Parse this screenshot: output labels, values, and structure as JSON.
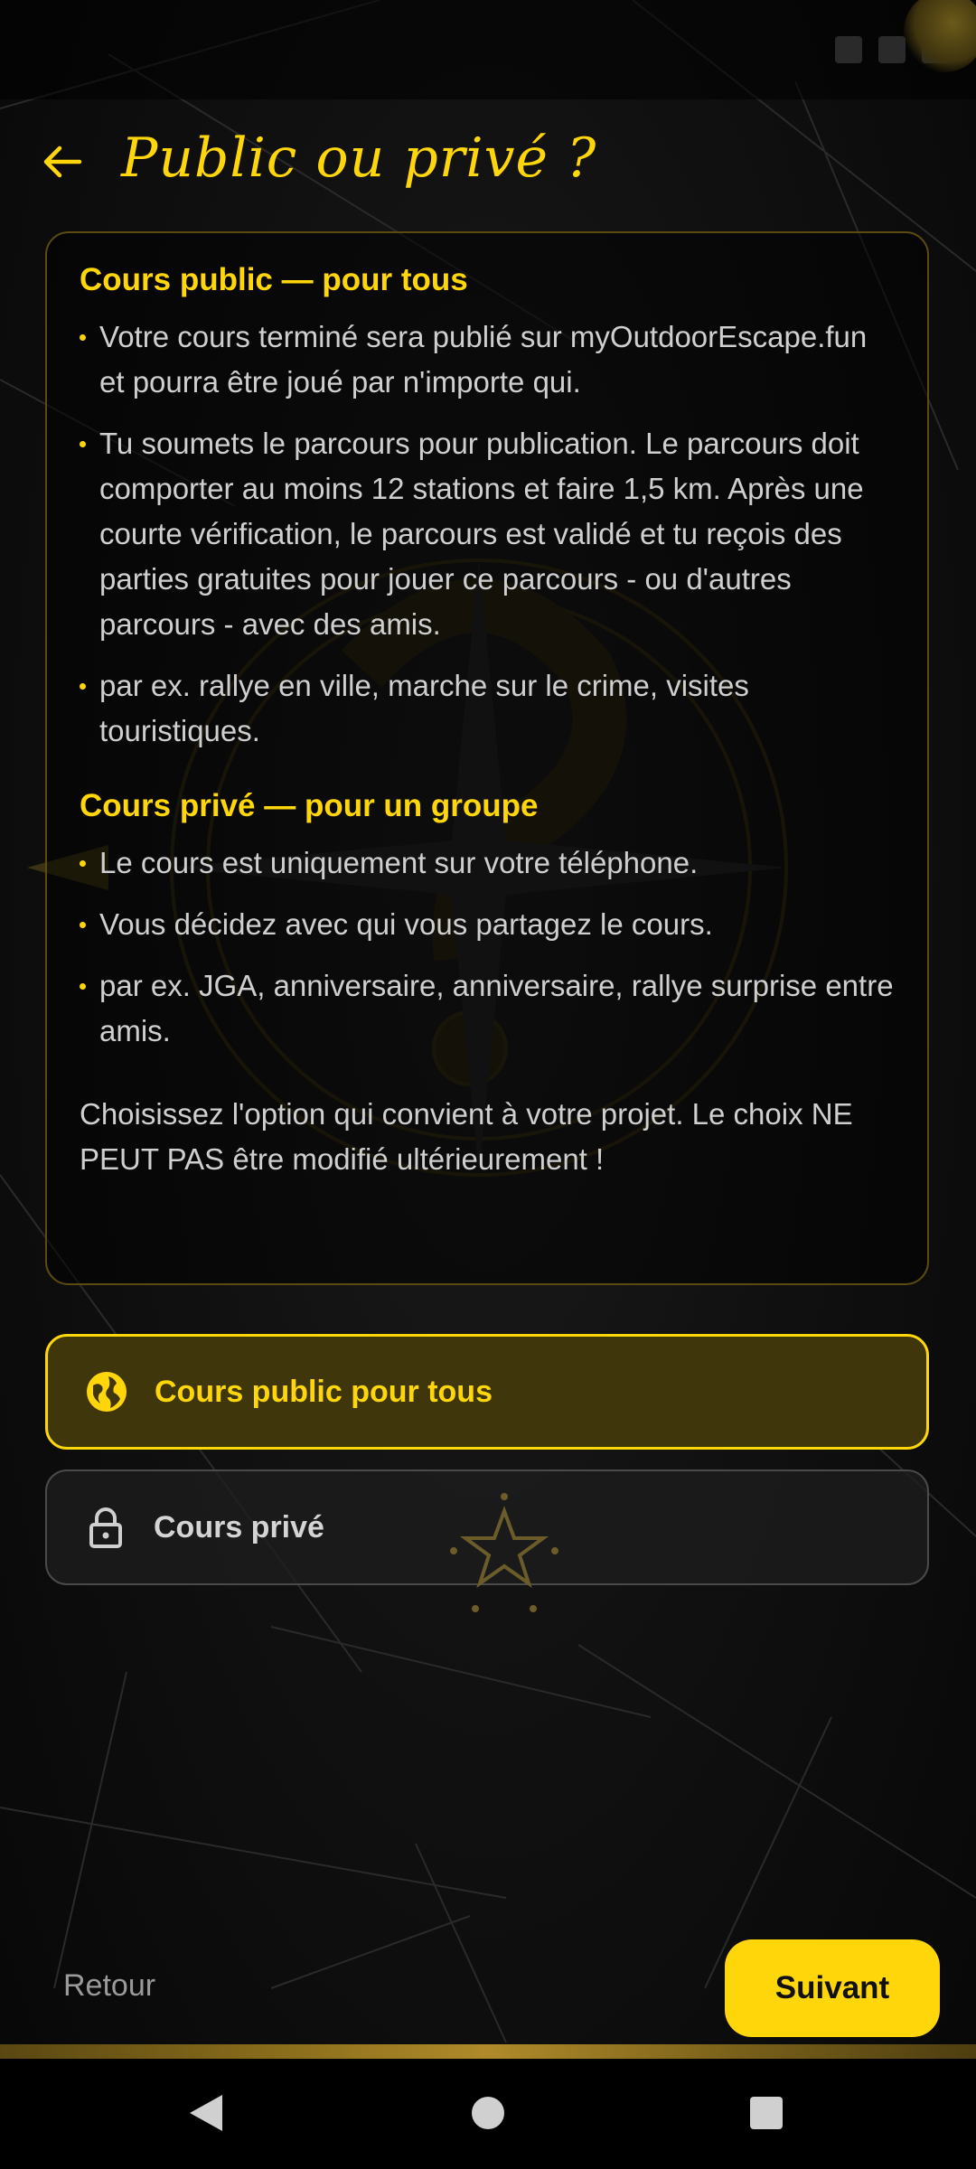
{
  "header": {
    "title": "Public ou privé ?"
  },
  "info": {
    "public": {
      "title": "Cours public — pour tous",
      "bullets": [
        "Votre cours terminé sera publié sur myOutdoorEscape.fun et pourra être joué par n'importe qui.",
        "Tu soumets le parcours pour publication. Le parcours doit comporter au moins 12 stations et faire 1,5 km. Après une courte vérification, le parcours est validé et tu reçois des parties gratuites pour jouer ce parcours - ou d'autres parcours - avec des amis.",
        "par ex. rallye en ville, marche sur le crime, visites touristiques."
      ]
    },
    "private": {
      "title": "Cours privé — pour un groupe",
      "bullets": [
        "Le cours est uniquement sur votre téléphone.",
        "Vous décidez avec qui vous partagez le cours.",
        "par ex. JGA, anniversaire, anniversaire, rallye surprise entre amis."
      ]
    },
    "note": "Choisissez l'option qui convient à votre projet. Le choix NE PEUT PAS être modifié ultérieurement !"
  },
  "options": {
    "public": {
      "label": "Cours public pour tous",
      "icon": "globe-icon",
      "selected": true
    },
    "private": {
      "label": "Cours privé",
      "icon": "lock-icon",
      "selected": false
    }
  },
  "footer": {
    "back_label": "Retour",
    "next_label": "Suivant"
  },
  "colors": {
    "accent": "#ffd60a",
    "background": "#0b0b0b",
    "selected_fill": "#3f360b"
  }
}
